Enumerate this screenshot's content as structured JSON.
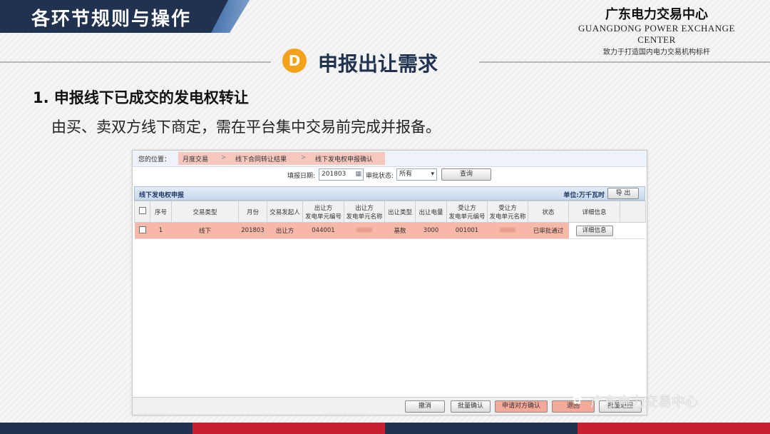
{
  "header": {
    "banner_title": "各环节规则与操作",
    "org_name_cn": "广东电力交易中心",
    "org_name_en": "GUANGDONG POWER EXCHANGE CENTER",
    "slogan": "致力于打造国内电力交易机构标杆"
  },
  "section": {
    "icon_letter": "D",
    "title": "申报出让需求",
    "item_title": "1. 申报线下已成交的发电权转让",
    "item_desc": "由买、卖双方线下商定，需在平台集中交易前完成并报备。"
  },
  "app": {
    "breadcrumb": {
      "prefix": "您的位置：",
      "items": [
        "月度交易",
        "线下合同转让结果",
        "线下发电权申报确认"
      ]
    },
    "filter": {
      "date_label": "填报日期:",
      "date_value": "201803",
      "status_label": "审批状态:",
      "status_value": "所有",
      "query_button": "查询"
    },
    "grid": {
      "title": "线下发电权申报",
      "unit": "单位:万千瓦时",
      "export_button": "导 出",
      "columns": [
        "序号",
        "交易类型",
        "月份",
        "交易发起人",
        "出让方\n发电单元编号",
        "出让方\n发电单元名称",
        "出让类型",
        "出让电量",
        "受让方\n发电单元编号",
        "受让方\n发电单元名称",
        "状态",
        "详细信息"
      ],
      "rows": [
        {
          "no": "1",
          "type": "线下",
          "month": "201803",
          "initiator": "出让方",
          "seller_code": "044001",
          "seller_name": "",
          "sell_type": "基数",
          "quantity": "3000",
          "buyer_code": "001001",
          "buyer_name": "",
          "status": "已审批通过",
          "detail_button": "详细信息"
        }
      ]
    },
    "footer_buttons": [
      "撤消",
      "批量确认",
      "申请对方确认",
      "退回",
      "批量退回"
    ]
  },
  "watermark": "广东电力交易中心"
}
